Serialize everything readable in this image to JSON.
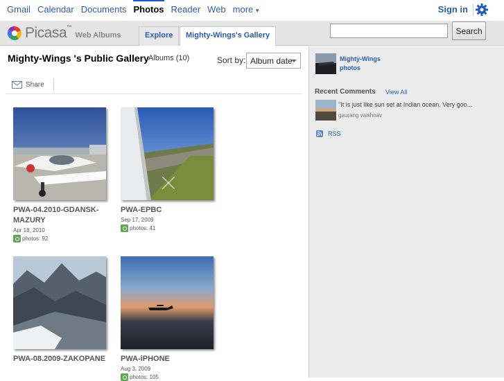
{
  "gbar": {
    "links": [
      "Gmail",
      "Calendar",
      "Documents",
      "Photos",
      "Reader",
      "Web",
      "more"
    ],
    "active": "Photos",
    "more_caret": "▾",
    "signin": "Sign in"
  },
  "header": {
    "logo_text": "Picasa",
    "logo_tm": "™",
    "web_albums": "Web Albums",
    "tab_explore": "Explore",
    "tab_gallery": "Mighty-Wings's Gallery",
    "search_placeholder": "",
    "search_button": "Search"
  },
  "gallery": {
    "title": "Mighty-Wings 's Public Gallery",
    "subtitle": "Albums (10)",
    "sort_label": "Sort by:",
    "sort_value": "Album date",
    "share_label": "Share",
    "albums": [
      {
        "title": "PWA-04.2010-GDANSK-MAZURY",
        "date": "Apr 18, 2010",
        "photos": "photos: 92"
      },
      {
        "title": "PWA-EPBC",
        "date": "Sep 17, 2009",
        "photos": "photos: 41"
      },
      {
        "title": "PWA-08.2009-ZAKOPANE",
        "date": "",
        "photos": ""
      },
      {
        "title": "PWA-iPHONE",
        "date": "Aug 3, 2009",
        "photos": "photos: 105"
      }
    ]
  },
  "sidebar": {
    "owner_name_1": "Mighty-Wings",
    "owner_name_2": "photos",
    "recent_comments_title": "Recent Comments",
    "view_all": "View All",
    "comment_text": "\"It is just like sun set at Indian ocean. Very goo...",
    "comment_author": "gaurang vaishnav",
    "rss": "RSS"
  },
  "colors": {
    "link_blue": "#2a5db0",
    "header_gray": "#e5e5e5",
    "sidebar_gray": "#ececec"
  }
}
